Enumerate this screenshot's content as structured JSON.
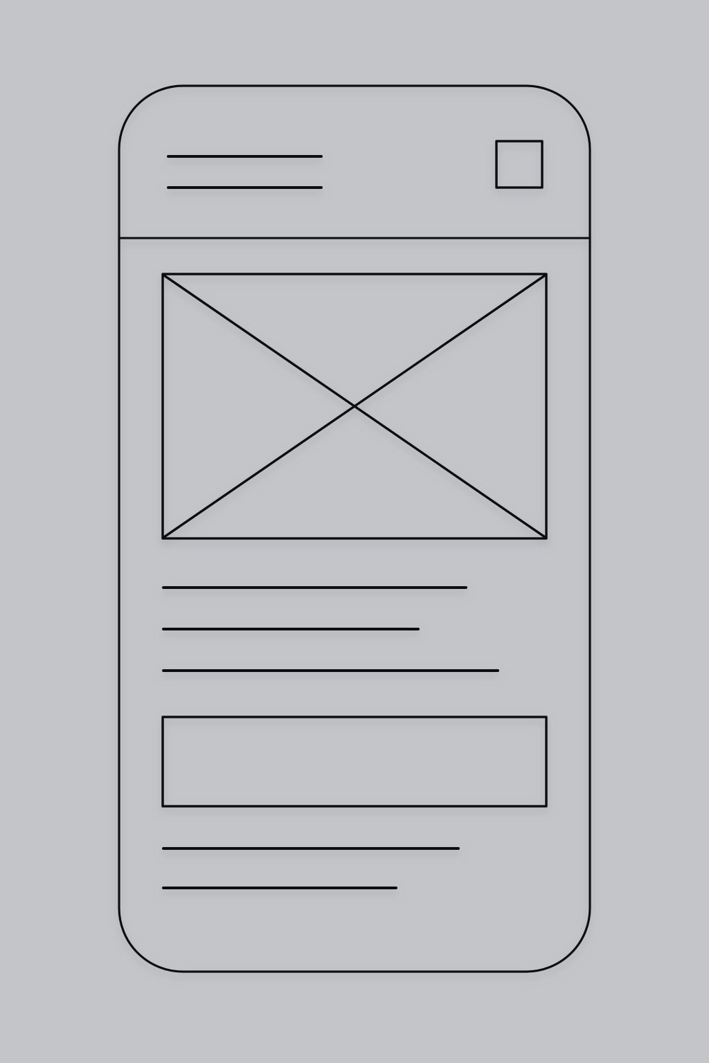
{
  "theme": {
    "background": "#c4c5c9",
    "stroke": "#111111",
    "shadow": "#8e9096"
  },
  "wireframe": {
    "device": "phone",
    "header": {
      "text_placeholder_lines": 2,
      "icon": "square-placeholder-icon"
    },
    "hero_image": {
      "icon": "image-placeholder-icon"
    },
    "body_text_placeholder_lines": 3,
    "button": "empty-rectangle-placeholder",
    "footer_text_placeholder_lines": 2
  }
}
